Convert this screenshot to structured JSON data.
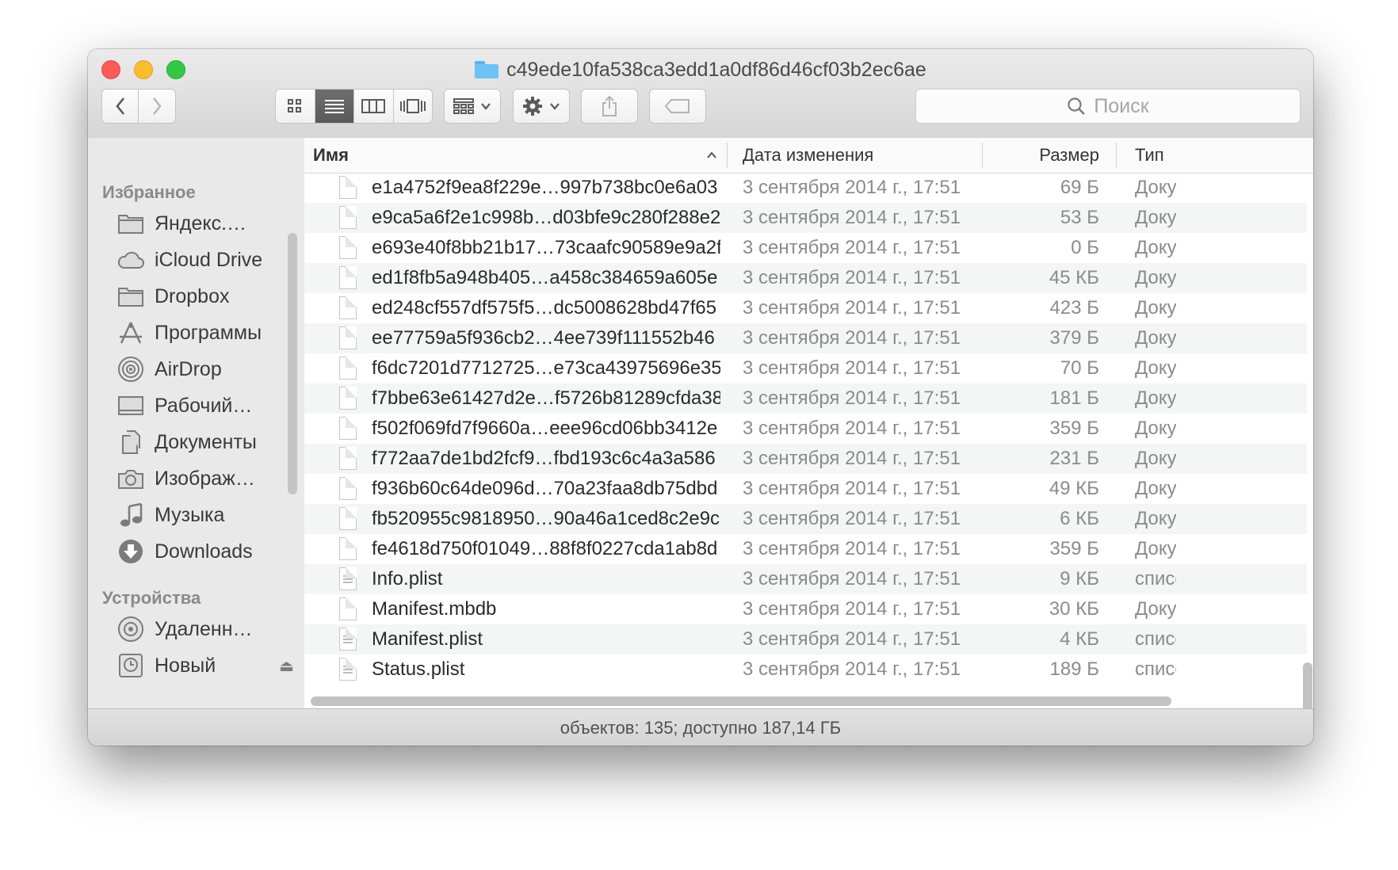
{
  "window": {
    "title": "c49ede10fa538ca3edd1a0df86d46cf03b2ec6ae",
    "status": "объектов: 135; доступно 187,14 ГБ"
  },
  "toolbar": {
    "back_icon": "chevron-left-icon",
    "forward_icon": "chevron-right-icon",
    "view_modes": [
      "icon-view",
      "list-view",
      "column-view",
      "cover-flow-view"
    ],
    "active_view": "list-view",
    "search_placeholder": "Поиск"
  },
  "sidebar": {
    "favorites_heading": "Избранное",
    "favorites": [
      {
        "label": "Яндекс.…",
        "icon": "folder-icon"
      },
      {
        "label": "iCloud Drive",
        "icon": "cloud-icon"
      },
      {
        "label": "Dropbox",
        "icon": "folder-icon"
      },
      {
        "label": "Программы",
        "icon": "applications-icon"
      },
      {
        "label": "AirDrop",
        "icon": "airdrop-icon"
      },
      {
        "label": "Рабочий…",
        "icon": "desktop-icon"
      },
      {
        "label": "Документы",
        "icon": "documents-icon"
      },
      {
        "label": "Изображ…",
        "icon": "camera-icon"
      },
      {
        "label": "Музыка",
        "icon": "music-icon"
      },
      {
        "label": "Downloads",
        "icon": "downloads-icon"
      }
    ],
    "devices_heading": "Устройства",
    "devices": [
      {
        "label": "Удаленн…",
        "icon": "disc-icon"
      },
      {
        "label": "Новый",
        "icon": "time-machine-icon"
      }
    ]
  },
  "columns": {
    "name": "Имя",
    "modified": "Дата изменения",
    "size": "Размер",
    "kind": "Тип"
  },
  "files": [
    {
      "name": "e1a4752f9ea8f229e…997b738bc0e6a03",
      "date": "3 сентября 2014 г., 17:51",
      "size": "69 Б",
      "kind": "Доку",
      "icon": "document-icon"
    },
    {
      "name": "e9ca5a6f2e1c998b…d03bfe9c280f288e2",
      "date": "3 сентября 2014 г., 17:51",
      "size": "53 Б",
      "kind": "Доку",
      "icon": "document-icon"
    },
    {
      "name": "e693e40f8bb21b17…73caafc90589e9a2f",
      "date": "3 сентября 2014 г., 17:51",
      "size": "0 Б",
      "kind": "Доку",
      "icon": "document-icon"
    },
    {
      "name": "ed1f8fb5a948b405…a458c384659a605e",
      "date": "3 сентября 2014 г., 17:51",
      "size": "45 КБ",
      "kind": "Доку",
      "icon": "document-icon"
    },
    {
      "name": "ed248cf557df575f5…dc5008628bd47f65",
      "date": "3 сентября 2014 г., 17:51",
      "size": "423 Б",
      "kind": "Доку",
      "icon": "document-icon"
    },
    {
      "name": "ee77759a5f936cb2…4ee739f111552b46",
      "date": "3 сентября 2014 г., 17:51",
      "size": "379 Б",
      "kind": "Доку",
      "icon": "document-icon"
    },
    {
      "name": "f6dc7201d7712725…e73ca43975696e35",
      "date": "3 сентября 2014 г., 17:51",
      "size": "70 Б",
      "kind": "Доку",
      "icon": "document-icon"
    },
    {
      "name": "f7bbe63e61427d2e…f5726b81289cfda38",
      "date": "3 сентября 2014 г., 17:51",
      "size": "181 Б",
      "kind": "Доку",
      "icon": "document-icon"
    },
    {
      "name": "f502f069fd7f9660a…eee96cd06bb3412e",
      "date": "3 сентября 2014 г., 17:51",
      "size": "359 Б",
      "kind": "Доку",
      "icon": "document-icon"
    },
    {
      "name": "f772aa7de1bd2fcf9…fbd193c6c4a3a586",
      "date": "3 сентября 2014 г., 17:51",
      "size": "231 Б",
      "kind": "Доку",
      "icon": "document-icon"
    },
    {
      "name": "f936b60c64de096d…70a23faa8db75dbd",
      "date": "3 сентября 2014 г., 17:51",
      "size": "49 КБ",
      "kind": "Доку",
      "icon": "document-icon"
    },
    {
      "name": "fb520955c9818950…90a46a1ced8c2e9c",
      "date": "3 сентября 2014 г., 17:51",
      "size": "6 КБ",
      "kind": "Доку",
      "icon": "document-icon"
    },
    {
      "name": "fe4618d750f01049…88f8f0227cda1ab8d",
      "date": "3 сентября 2014 г., 17:51",
      "size": "359 Б",
      "kind": "Доку",
      "icon": "document-icon"
    },
    {
      "name": "Info.plist",
      "date": "3 сентября 2014 г., 17:51",
      "size": "9 КБ",
      "kind": "списс",
      "icon": "plist-icon"
    },
    {
      "name": "Manifest.mbdb",
      "date": "3 сентября 2014 г., 17:51",
      "size": "30 КБ",
      "kind": "Доку",
      "icon": "document-icon"
    },
    {
      "name": "Manifest.plist",
      "date": "3 сентября 2014 г., 17:51",
      "size": "4 КБ",
      "kind": "списс",
      "icon": "plist-icon"
    },
    {
      "name": "Status.plist",
      "date": "3 сентября 2014 г., 17:51",
      "size": "189 Б",
      "kind": "списс",
      "icon": "plist-icon"
    }
  ]
}
